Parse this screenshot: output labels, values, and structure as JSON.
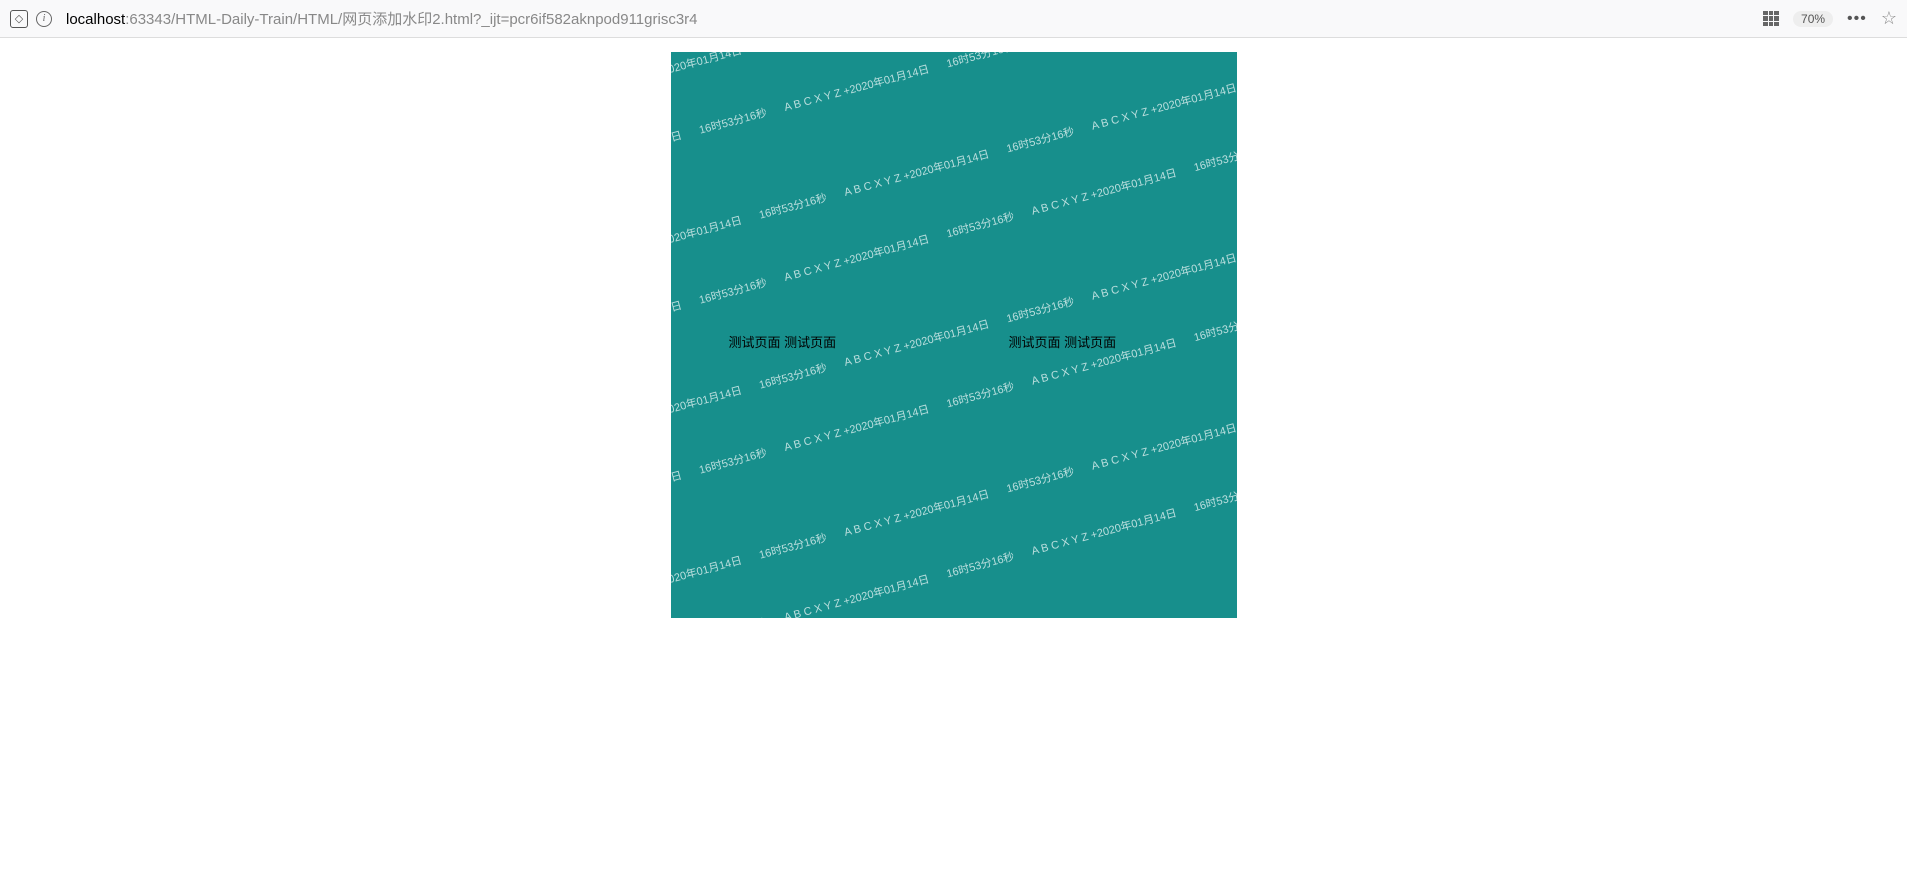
{
  "browser": {
    "url_host": "localhost",
    "url_path": ":63343/HTML-Daily-Train/HTML/网页添加水印2.html?_ijt=pcr6if582aknpod911grisc3r4",
    "zoom": "70%"
  },
  "page": {
    "watermark_line1": "A B C X Y Z +2020年01月14日",
    "watermark_line2": "16时53分16秒",
    "content_text_left": "测试页面 测试页面",
    "content_text_right": "测试页面 测试页面"
  }
}
